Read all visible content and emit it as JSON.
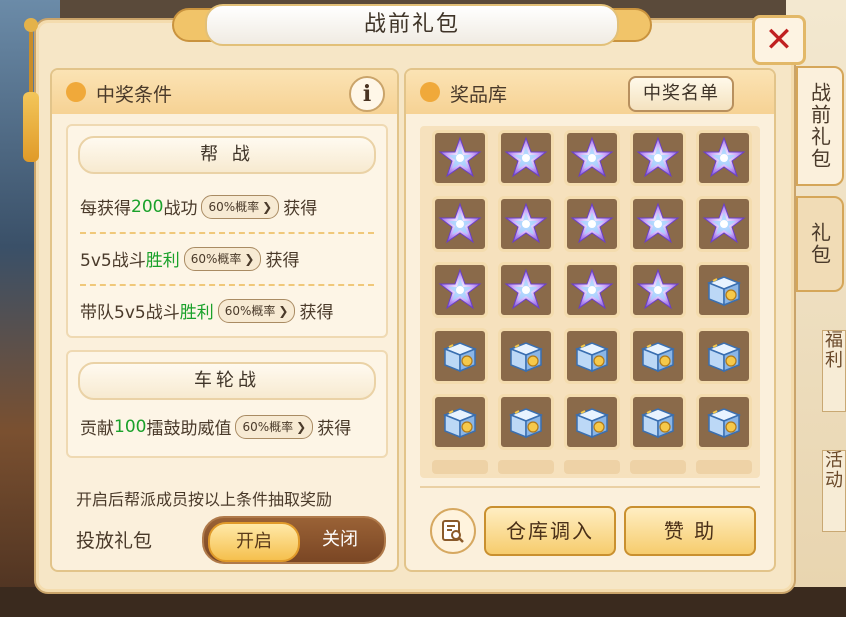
{
  "dialog": {
    "title": "战前礼包",
    "close_icon": "close-icon"
  },
  "side_tabs": [
    {
      "label": "战前礼包",
      "active": true
    },
    {
      "label": "礼包",
      "active": false
    }
  ],
  "background_side_text": [
    "福利",
    "活动"
  ],
  "conditions_panel": {
    "title": "中奖条件",
    "info_icon": "i",
    "sections": [
      {
        "heading": "帮 战",
        "rows": [
          {
            "prefix": "每获得",
            "highlight": "200",
            "suffix": "战功",
            "pill": "60%概率",
            "after": "获得"
          },
          {
            "prefix": "5v5战斗",
            "highlight": "胜利",
            "suffix": "",
            "pill": "60%概率",
            "after": "获得"
          },
          {
            "prefix": "带队5v5战斗",
            "highlight": "胜利",
            "suffix": "",
            "pill": "60%概率",
            "after": "获得"
          }
        ]
      },
      {
        "heading": "车轮战",
        "rows": [
          {
            "prefix": "贡献",
            "highlight": "100",
            "suffix": "擂鼓助威值",
            "pill": "60%概率",
            "after": "获得"
          }
        ]
      }
    ],
    "note": "开启后帮派成员按以上条件抽取奖励",
    "gift_toggle": {
      "label": "投放礼包",
      "on_label": "开启",
      "off_label": "关闭",
      "state": "on"
    }
  },
  "prize_panel": {
    "title": "奖品库",
    "winners_button": "中奖名单",
    "items": [
      "star-crystal",
      "star-crystal",
      "star-crystal",
      "star-crystal",
      "star-crystal",
      "star-crystal",
      "star-crystal",
      "star-crystal",
      "star-crystal",
      "star-crystal",
      "star-crystal",
      "star-crystal",
      "star-crystal",
      "star-crystal",
      "treasure-chest",
      "treasure-chest",
      "treasure-chest",
      "treasure-chest",
      "treasure-chest",
      "treasure-chest",
      "treasure-chest",
      "treasure-chest",
      "treasure-chest",
      "treasure-chest",
      "treasure-chest"
    ],
    "search_icon": "magnifier-icon",
    "warehouse_button": "仓库调入",
    "sponsor_button": "赞 助"
  },
  "colors": {
    "highlight_green": "#1aa12a",
    "close_red": "#c02020",
    "panel_bg": "#fbf0dc",
    "gold_button": "#f6cc6d"
  }
}
